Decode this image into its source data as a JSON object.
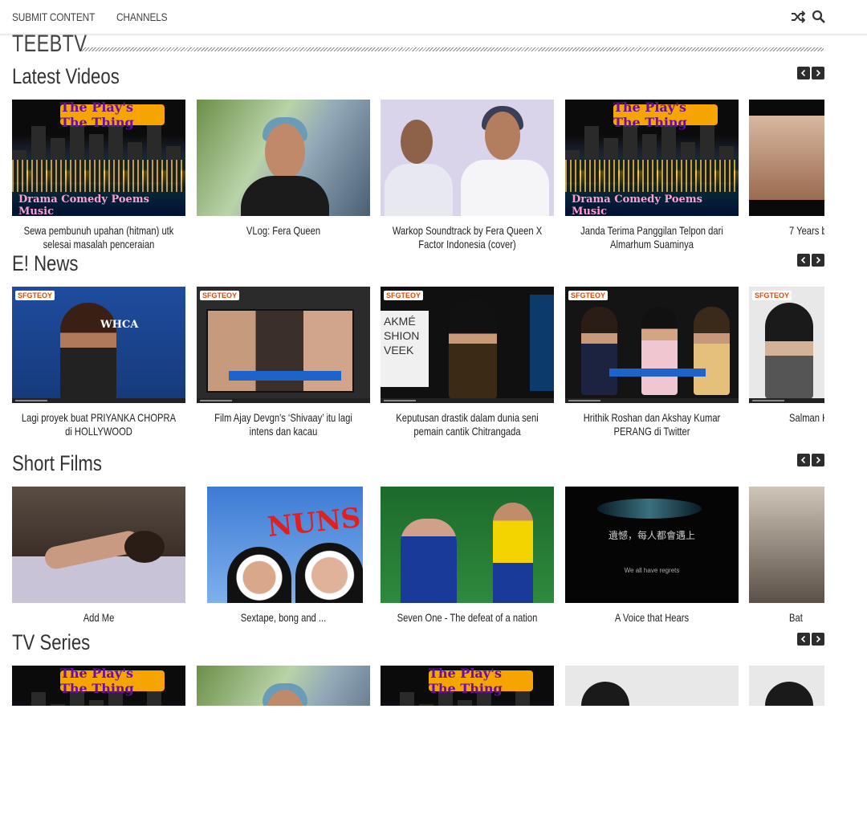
{
  "nav": {
    "links": [
      "SUBMIT CONTENT",
      "CHANNELS"
    ],
    "icons": [
      "shuffle-icon",
      "search-icon"
    ]
  },
  "site": {
    "title": "TEEBTV"
  },
  "sections": [
    {
      "title": "Latest Videos",
      "items": [
        {
          "caption": "Sewa pembunuh upahan (hitman) utk selesai masalah penceraian",
          "thumb": "city",
          "banner": "The Play's The Thing",
          "subtitle": "Drama Comedy Poems Music"
        },
        {
          "caption": "VLog: Fera Queen",
          "thumb": "vlog"
        },
        {
          "caption": "Warkop Soundtrack by Fera Queen X Factor Indonesia (cover)",
          "thumb": "duet"
        },
        {
          "caption": "Janda Terima Panggilan Telpon dari Almarhum Suaminya",
          "thumb": "city",
          "banner": "The Play's The Thing",
          "subtitle": "Drama Comedy Poems Music"
        },
        {
          "caption": "7 Years b",
          "thumb": "band"
        }
      ]
    },
    {
      "title": "E! News",
      "items": [
        {
          "caption": "Lagi proyek buat PRIYANKA CHOPRA di HOLLYWOOD",
          "thumb": "priyanka",
          "logo": "SFGTEOY",
          "tag": "WHCA"
        },
        {
          "caption": "Film Ajay Devgn's ‘Shivaay’ itu lagi intens dan kacau",
          "thumb": "ajay",
          "logo": "SFGTEOY"
        },
        {
          "caption": "Keputusan drastik dalam dunia seni pemain cantik Chitrangada",
          "thumb": "chitra",
          "logo": "SFGTEOY",
          "tag": "AKMÉ SHION VEEK"
        },
        {
          "caption": "Hrithik Roshan dan Akshay Kumar PERANG di Twitter",
          "thumb": "akshay",
          "logo": "SFGTEOY"
        },
        {
          "caption": "Salman Khan t beauty Zhu Z 'Tı",
          "thumb": "salman",
          "logo": "SFGTEOY"
        }
      ]
    },
    {
      "title": "Short Films",
      "items": [
        {
          "caption": "Add Me",
          "thumb": "bed"
        },
        {
          "caption": "Sextape, bong and ...",
          "thumb": "nuns",
          "tag": "NUNS"
        },
        {
          "caption": "Seven One - The defeat of a nation",
          "thumb": "soccer"
        },
        {
          "caption": "A Voice that Hears",
          "thumb": "dark",
          "tag": "遺憾，每人都會遇上",
          "tag2": "We all have regrets"
        },
        {
          "caption": "Bat",
          "thumb": "slum"
        }
      ]
    },
    {
      "title": "TV Series",
      "items": [
        {
          "caption": "",
          "thumb": "city",
          "banner": "The Play's The Thing",
          "subtitle": ""
        },
        {
          "caption": "",
          "thumb": "vlog"
        },
        {
          "caption": "",
          "thumb": "city",
          "banner": "The Play's The Thing",
          "subtitle": ""
        },
        {
          "caption": "",
          "thumb": "salman"
        },
        {
          "caption": "",
          "thumb": "salman"
        }
      ]
    }
  ]
}
